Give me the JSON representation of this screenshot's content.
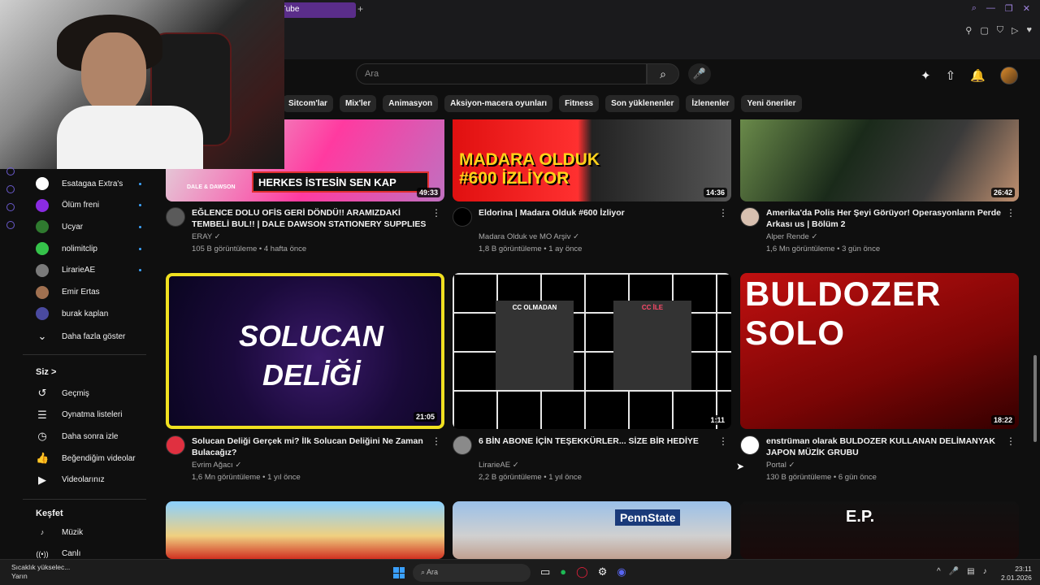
{
  "browser": {
    "tab_title": "Tube",
    "new_tab": "+"
  },
  "header": {
    "search_placeholder": "Ara"
  },
  "chips": [
    "Sitcom'lar",
    "Mix'ler",
    "Animasyon",
    "Aksiyon-macera oyunları",
    "Fitness",
    "Son yüklenenler",
    "İzlenenler",
    "Yeni öneriler"
  ],
  "subscriptions": [
    {
      "label": "Esatagaa Extra's",
      "color": "#ffffff",
      "dot": true
    },
    {
      "label": "Ölüm freni",
      "color": "#8a2be2",
      "dot": true
    },
    {
      "label": "Ucyar",
      "color": "#2f7a2f",
      "dot": true
    },
    {
      "label": "nolimitclip",
      "color": "#35c24a",
      "dot": true
    },
    {
      "label": "LirarieAE",
      "color": "#7a7a7a",
      "dot": true
    },
    {
      "label": "Emir Ertas",
      "color": "#a07050",
      "dot": false
    },
    {
      "label": "burak kaplan",
      "color": "#4a4aa0",
      "dot": false
    }
  ],
  "show_more": "Daha fazla göster",
  "you_section": {
    "title": "Siz",
    "chevron": ">",
    "items": [
      "Geçmiş",
      "Oynatma listeleri",
      "Daha sonra izle",
      "Beğendiğim videolar",
      "Videolarınız"
    ]
  },
  "explore_section": {
    "title": "Keşfet",
    "items": [
      "Müzik",
      "Canlı"
    ]
  },
  "videos": [
    {
      "title": "EĞLENCE DOLU OFİS GERİ DÖNDÜ!! ARAMIZDAKİ TEMBELİ BUL!! | DALE DAWSON STATIONERY SUPPLIES",
      "channel": "ERAY",
      "stats": "105 B görüntüleme • 4 hafta önce",
      "duration": "49:33",
      "thumb_text": "HERKES İSTESİN SEN KAP",
      "logo_text": "DALE & DAWSON",
      "av": "#5a5a5a"
    },
    {
      "title": "Eldorina | Madara Olduk #600 İzliyor",
      "channel": "Madara Olduk ve MO Arşiv",
      "stats": "1,8 B görüntüleme • 1 ay önce",
      "duration": "14:36",
      "thumb_text": "MADARA OLDUK #600 İZLİYOR",
      "av": "#000000"
    },
    {
      "title": "Amerika'da Polis Her Şeyi Görüyor! Operasyonların Perde Arkası us | Bölüm 2",
      "channel": "Alper Rende",
      "stats": "1,6 Mn görüntüleme • 3 gün önce",
      "duration": "26:42",
      "av": "#d8c0b0"
    },
    {
      "title": "Solucan Deliği Gerçek mi? İlk Solucan Deliğini Ne Zaman Bulacağız?",
      "channel": "Evrim Ağacı",
      "stats": "1,6 Mn görüntüleme • 1 yıl önce",
      "duration": "21:05",
      "thumb_text": "SOLUCAN DELİĞİ",
      "av": "#e03040"
    },
    {
      "title": "6 BİN ABONE İÇİN TEŞEKKÜRLER... SİZE BİR HEDİYE",
      "channel": "LirarieAE",
      "stats": "2,2 B görüntüleme • 1 yıl önce",
      "duration": "1:11",
      "thumb_left": "CC OLMADAN",
      "thumb_right": "CC İLE",
      "av": "#8a8a8a"
    },
    {
      "title": "enstrüman olarak BULDOZER KULLANAN DELİMANYAK JAPON MÜZİK GRUBU",
      "channel": "Portal",
      "stats": "130 B görüntüleme • 6 gün önce",
      "duration": "18:22",
      "thumb_text": "BULDOZER SOLO",
      "av": "#ffffff"
    },
    {
      "title": "",
      "channel": "",
      "stats": "",
      "duration": "",
      "av": "#000"
    },
    {
      "title": "",
      "channel": "",
      "stats": "",
      "duration": "",
      "thumb_text": "PennState",
      "av": "#000"
    },
    {
      "title": "",
      "channel": "",
      "stats": "",
      "duration": "",
      "thumb_text": "E.P.",
      "av": "#000"
    }
  ],
  "taskbar": {
    "weather_line1": "Sıcaklık yükselec...",
    "weather_line2": "Yarın",
    "search": "Ara",
    "time": "23:11",
    "date": "2.01.2026"
  },
  "colors": {
    "accent": "#3ea6ff",
    "tab": "#5a2d8a",
    "bg": "#0f0f0f"
  }
}
